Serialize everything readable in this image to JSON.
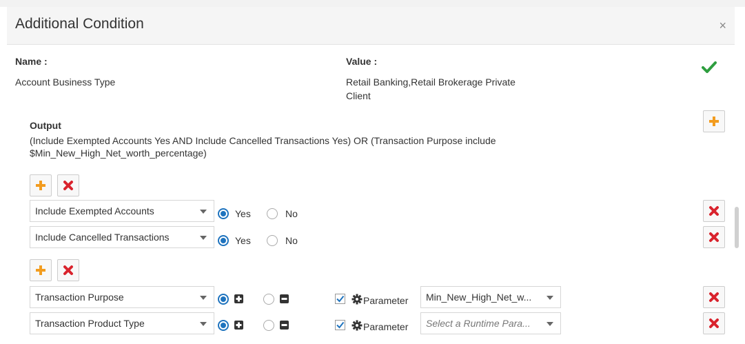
{
  "dialog": {
    "title": "Additional Condition",
    "close_label": "×"
  },
  "condition": {
    "name_label": "Name :",
    "value_label": "Value :",
    "name": "Account Business Type",
    "value_line1": "Retail Banking,Retail Brokerage Private",
    "value_line2": "Client"
  },
  "output": {
    "title": "Output",
    "text_line1": "(Include Exempted Accounts Yes AND Include Cancelled Transactions Yes) OR (Transaction Purpose include",
    "text_line2": "$Min_New_High_Net_worth_percentage)"
  },
  "group1": {
    "rows": [
      {
        "field": "Include Exempted Accounts",
        "opt_yes": "Yes",
        "opt_no": "No",
        "selected": "Yes"
      },
      {
        "field": "Include Cancelled Transactions",
        "opt_yes": "Yes",
        "opt_no": "No",
        "selected": "Yes"
      }
    ]
  },
  "group2": {
    "rows": [
      {
        "field": "Transaction Purpose",
        "include": true,
        "parameter_checked": true,
        "parameter_label": "Parameter",
        "param_value": "Min_New_High_Net_w...",
        "param_placeholder": ""
      },
      {
        "field": "Transaction Product Type",
        "include": true,
        "parameter_checked": true,
        "parameter_label": "Parameter",
        "param_value": "",
        "param_placeholder": "Select a Runtime Para..."
      }
    ]
  },
  "colors": {
    "add_icon": "#f29c1f",
    "remove_icon": "#d9232d",
    "confirm_icon": "#2e9e3f",
    "radio_selected": "#1e73be"
  },
  "icons": [
    "close-icon",
    "green-check-icon",
    "add-icon",
    "remove-icon",
    "include-plus-icon",
    "exclude-minus-icon",
    "gear-icon",
    "checkbox-check-icon",
    "chevron-down-icon"
  ]
}
